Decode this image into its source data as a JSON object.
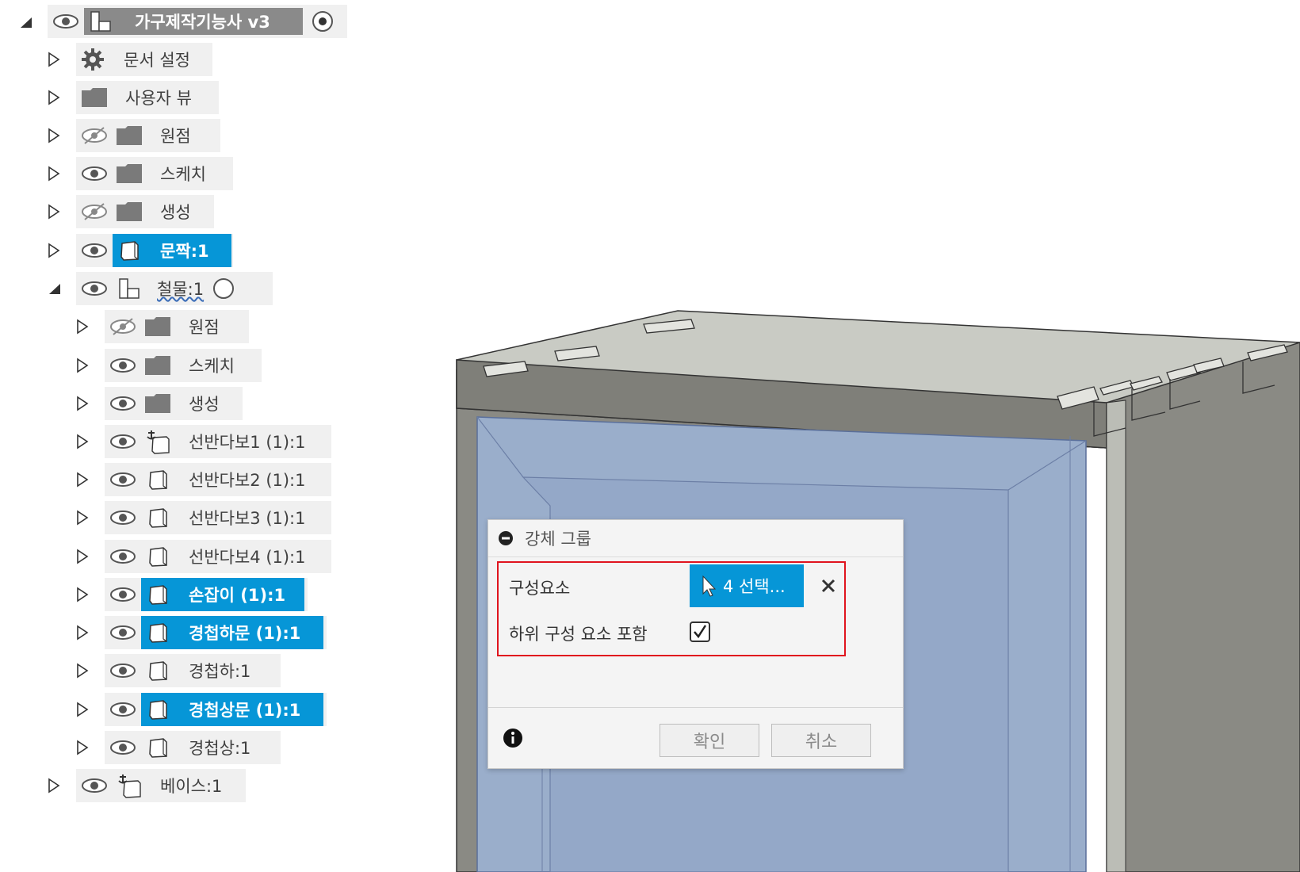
{
  "browser": {
    "root": {
      "label": "가구제작기능사 v3"
    },
    "items": [
      {
        "label": "문서 설정"
      },
      {
        "label": "사용자 뷰"
      },
      {
        "label": "원점"
      },
      {
        "label": "스케치"
      },
      {
        "label": "생성"
      },
      {
        "label": "문짝:1"
      },
      {
        "label": "철물:1"
      },
      {
        "label": "원점"
      },
      {
        "label": "스케치"
      },
      {
        "label": "생성"
      },
      {
        "label": "선반다보1 (1):1"
      },
      {
        "label": "선반다보2 (1):1"
      },
      {
        "label": "선반다보3 (1):1"
      },
      {
        "label": "선반다보4 (1):1"
      },
      {
        "label": "손잡이 (1):1"
      },
      {
        "label": "경첩하문 (1):1"
      },
      {
        "label": "경첩하:1"
      },
      {
        "label": "경첩상문 (1):1"
      },
      {
        "label": "경첩상:1"
      },
      {
        "label": "베이스:1"
      }
    ]
  },
  "dialog": {
    "title": "강체 그룹",
    "component_label": "구성요소",
    "selection_button": "4 선택...",
    "include_sub_label": "하위 구성 요소 포함",
    "include_sub_checked": true,
    "ok": "확인",
    "cancel": "취소"
  },
  "colors": {
    "selection": "#0696d7",
    "highlight_box": "#e0141e",
    "model_gray": "#8a8a84",
    "door_blue": "#9aaecb"
  },
  "icons": [
    "expand-arrow-icon",
    "collapse-arrow-icon",
    "eye-icon",
    "eye-hidden-icon",
    "gear-icon",
    "folder-icon",
    "body-icon",
    "component-icon",
    "anchor-component-icon",
    "radio-icon",
    "cursor-icon",
    "close-icon",
    "info-icon",
    "checkbox-icon"
  ]
}
